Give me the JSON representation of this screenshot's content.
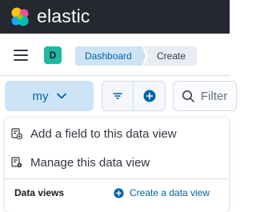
{
  "header": {
    "brand": "elastic",
    "logo_icon": "elastic-logo-icon"
  },
  "subbar": {
    "menu_icon": "hamburger-icon",
    "avatar_initial": "D",
    "breadcrumbs": [
      "Dashboard",
      "Create"
    ]
  },
  "toolbar": {
    "data_view_label": "my",
    "data_view_icon": "chevron-down-icon",
    "filter_icon": "filter-icon",
    "add_filter_icon": "plus-circle-icon",
    "search_placeholder": "Filter"
  },
  "popover": {
    "items": [
      {
        "label": "Add a field to this data view",
        "icon": "list-add-icon"
      },
      {
        "label": "Manage this data view",
        "icon": "list-settings-icon"
      }
    ],
    "footer_title": "Data views",
    "create_label": "Create a data view",
    "create_icon": "plus-circle-icon"
  },
  "colors": {
    "header_bg": "#25282f",
    "accent": "#0061a6",
    "accent_light": "#cce4f5",
    "avatar": "#20b8a3"
  }
}
